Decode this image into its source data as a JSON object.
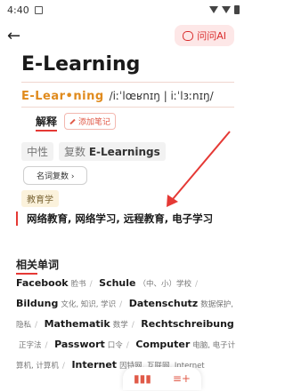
{
  "status": {
    "time": "4:40"
  },
  "header": {
    "ask_ai": "问问AI"
  },
  "entry": {
    "headword": "E-Learning",
    "syllables": "E-Lear•ning",
    "ipa": "/iːˈlœʁnɪŋ | iːˈlɜːnɪŋ/",
    "def_label": "解释",
    "add_note": "添加笔记",
    "gender": "中性",
    "plural_label": "复数",
    "plural_value": "E-Learnings",
    "noun_plural_btn": "名词复数 ›",
    "field": "教育学",
    "meaning": "网络教育, 网络学习, 远程教育, 电子学习"
  },
  "related": {
    "title": "相关单词",
    "items": [
      {
        "word": "Facebook",
        "gloss": "脸书"
      },
      {
        "word": "Schule",
        "gloss": "（中、小）学校"
      },
      {
        "word": "Bildung",
        "gloss": "文化, 知识, 学识"
      },
      {
        "word": "Datenschutz",
        "gloss": "数据保护, 隐私"
      },
      {
        "word": "Mathematik",
        "gloss": "数学"
      },
      {
        "word": "Rechtschreibung",
        "gloss": "正字法"
      },
      {
        "word": "Passwort",
        "gloss": "口令"
      },
      {
        "word": "Computer",
        "gloss": "电脑, 电子计算机, 计算机"
      },
      {
        "word": "Internet",
        "gloss": "因特网, 互联网, Internet"
      }
    ]
  },
  "colors": {
    "accent": "#e53935",
    "orange": "#e08b1e"
  }
}
